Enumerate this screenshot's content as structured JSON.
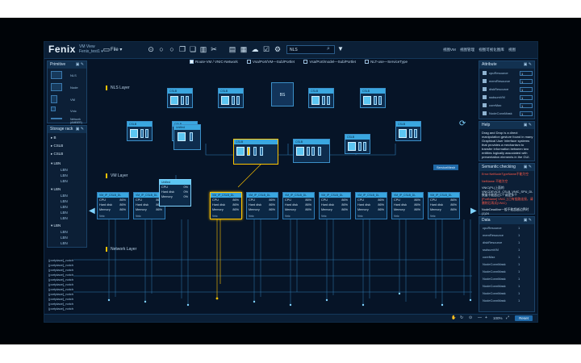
{
  "app": {
    "logo": "Fenix",
    "sub1": "VM View",
    "sub2": "Fenix_test1 ▾",
    "file_menu": "File ▾",
    "search_value": "NLS",
    "breadcrumbs": [
      "视图VM",
      "视图管理",
      "视图可视化图库",
      "视图"
    ]
  },
  "checks": [
    {
      "label": "Route-VM / VNIC-Network",
      "checked": true
    },
    {
      "label": "Vsa/Port/VM—Sub/Portlet",
      "checked": false
    },
    {
      "label": "Vsa/Port/model—Sub/Portlet",
      "checked": false
    },
    {
      "label": "NLT-use—ServiceType",
      "checked": false
    }
  ],
  "primitive": {
    "title": "Primitive",
    "items": [
      "NLS",
      "Node",
      "VM",
      "Vnic",
      "Network (AMBER)"
    ]
  },
  "storage": {
    "title": "Storage rack",
    "items": [
      "B",
      "CSLB",
      "CSLB",
      "LBN",
      "LBN",
      "LBN"
    ],
    "subitems": [
      "LBN",
      "LBN",
      "LBN",
      "LBN",
      "LBN",
      "LBN",
      "LBN",
      "LBN",
      "LBN",
      "LBN",
      "LBN",
      "LBN"
    ]
  },
  "layers": {
    "nls": "NLS Layer",
    "vm": "VM Layer",
    "network": "Network Layer"
  },
  "nls_boxes": [
    "CSLB",
    "CSLB",
    "CSLB",
    "CSLB",
    "CSLB",
    "CSLB",
    "Unified",
    "CSLB",
    "CSLB",
    "CSLB",
    "CSLB"
  ],
  "center_node": "BS",
  "vm_cards": {
    "header": "VM_IP_CSLB_DL",
    "rows": [
      {
        "label": "CPU",
        "value": "86%"
      },
      {
        "label": "Hard disk",
        "value": "86%"
      },
      {
        "label": "Memory",
        "value": "86%"
      }
    ],
    "footer": "Vnic"
  },
  "tooltip": {
    "title": "Unified",
    "rows": [
      {
        "label": "CPU",
        "value": "0%"
      },
      {
        "label": "Hard disk",
        "value": "0%"
      },
      {
        "label": "Memory",
        "value": "0%"
      }
    ]
  },
  "float_tag": "ServiceMesh",
  "ports": [
    "[portplace]_notch",
    "[portplace]_notch",
    "[portplace]_notch",
    "[portplace]_notch",
    "[portplace]_notch",
    "[portplace]_notch",
    "[portplace]_notch",
    "[portplace]_notch",
    "[portplace]_notch",
    "[portplace]_notch",
    "[portplace]_notch"
  ],
  "attribute": {
    "title": "Attribute",
    "rows": [
      {
        "label": "cpuResource",
        "value": "1"
      },
      {
        "label": "memResource",
        "value": "1"
      },
      {
        "label": "diskResource",
        "value": "1"
      },
      {
        "label": "ssdsumVM",
        "value": "1"
      },
      {
        "label": "coreMax",
        "value": "1"
      },
      {
        "label": "NodeConnMask",
        "value": "1"
      }
    ]
  },
  "help": {
    "title": "Help",
    "text": "Drag and Drop is a direct manipulation gesture found in many Graphical User Interface systems that provides a mechanism to transfer information between two entities logically associated with presentation elements in the GUI."
  },
  "semantic": {
    "title": "Semantic checking",
    "rows": [
      {
        "text": "Error:NetNodeTypeName不能为空",
        "color": "#ff5a4a"
      },
      {
        "text": "NetName 不能为空",
        "color": "#ff5a4a"
      },
      {
        "text": "VNIC(PL)上面的VNICDEVICE_CSLB_VNIC_SPU_DL数量不能超过1个或是多个",
        "color": "#cfe3f2"
      },
      {
        "text": "[PortName] VNIC上已有链路连接，请删除后再试(VNIC)",
        "color": "#ff5a4a"
      },
      {
        "text": "NodeDeadline一般不能超越边界时(1)24",
        "color": "#cfe3f2"
      }
    ]
  },
  "data_panel": {
    "title": "Data",
    "rows": [
      {
        "label": "cpuResource",
        "value": "1"
      },
      {
        "label": "memResource",
        "value": "1"
      },
      {
        "label": "diskResource",
        "value": "1"
      },
      {
        "label": "ssdsumVM",
        "value": "1"
      },
      {
        "label": "coreMax",
        "value": "1"
      },
      {
        "label": "NodeConnMask",
        "value": "1"
      },
      {
        "label": "NodeConnMask",
        "value": "1"
      },
      {
        "label": "NodeConnMask",
        "value": "1"
      },
      {
        "label": "NodeConnMask",
        "value": "1"
      },
      {
        "label": "NodeConnMask",
        "value": "1"
      },
      {
        "label": "NodeConnMask",
        "value": "1"
      }
    ]
  },
  "status": {
    "zoom": "100%",
    "reset": "Reset"
  },
  "colors": {
    "accent": "#3aa7e0",
    "highlight": "#ffc400",
    "bg": "#061427"
  }
}
